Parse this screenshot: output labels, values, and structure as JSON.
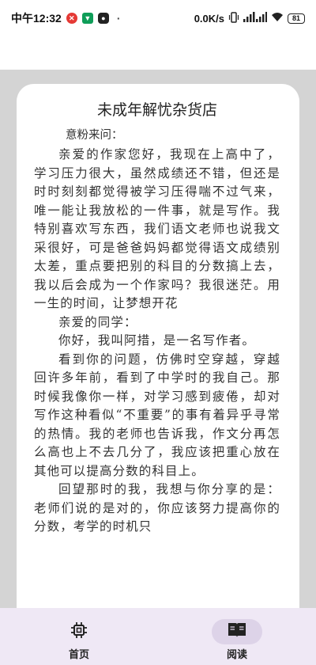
{
  "status_bar": {
    "time": "中午12:32",
    "network_speed": "0.0K/s",
    "battery": "81",
    "icons": [
      "app-red-icon",
      "app-green-icon",
      "app-black-icon",
      "vibrate-icon",
      "signal-icon",
      "wifi-icon",
      "battery-icon"
    ]
  },
  "letter": {
    "title": "未成年解忧杂货店",
    "from_line": "意粉来问：",
    "paragraphs": [
      "亲爱的作家您好，我现在上高中了，学习压力很大，虽然成绩还不错，但还是时时刻刻都觉得被学习压得喘不过气来，唯一能让我放松的一件事，就是写作。我特别喜欢写东西，我们语文老师也说我文采很好，可是爸爸妈妈都觉得语文成绩别太差，重点要把别的科目的分数搞上去，我以后会成为一个作家吗？我很迷茫。用一生的时间，让梦想开花",
      "亲爱的同学：",
      "你好，我叫阿措，是一名写作者。",
      "看到你的问题，仿佛时空穿越，穿越回许多年前，看到了中学时的我自己。那时候我像你一样，对学习感到疲倦，却对写作这种看似“不重要”的事有着异乎寻常的热情。我的老师也告诉我，作文分再怎么高也上不去几分了，我应该把重心放在其他可以提高分数的科目上。",
      "回望那时的我，我想与你分享的是：老师们说的是对的，你应该努力提高你的分数，考学的时机只"
    ]
  },
  "bottom_nav": {
    "items": [
      {
        "label": "首页",
        "icon": "chip-icon",
        "active": false
      },
      {
        "label": "阅读",
        "icon": "book-icon",
        "active": true
      }
    ]
  },
  "colors": {
    "page_bg": "#d4d4d4",
    "paper_bg": "#ffffff",
    "nav_bg": "#efe8f5",
    "nav_active": "#ddd3e8"
  }
}
